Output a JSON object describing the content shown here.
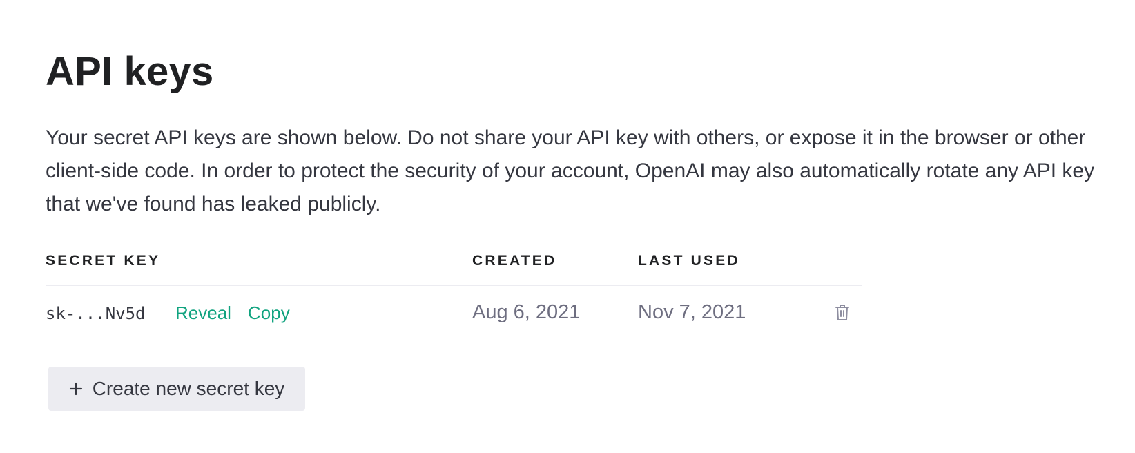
{
  "page": {
    "title": "API keys",
    "description": "Your secret API keys are shown below. Do not share your API key with others, or expose it in the browser or other client-side code. In order to protect the security of your account, OpenAI may also automatically rotate any API key that we've found has leaked publicly."
  },
  "table": {
    "headers": {
      "secret_key": "SECRET KEY",
      "created": "CREATED",
      "last_used": "LAST USED"
    },
    "rows": [
      {
        "key": "sk-...Nv5d",
        "reveal_label": "Reveal",
        "copy_label": "Copy",
        "created": "Aug 6, 2021",
        "last_used": "Nov 7, 2021",
        "delete_icon": "trash-icon"
      }
    ]
  },
  "actions": {
    "create_label": "Create new secret key",
    "create_icon": "plus-icon"
  },
  "colors": {
    "accent": "#10a37f",
    "button_bg": "#ececf1",
    "text": "#353740",
    "muted": "#6e6e80",
    "icon": "#8e8ea0"
  }
}
